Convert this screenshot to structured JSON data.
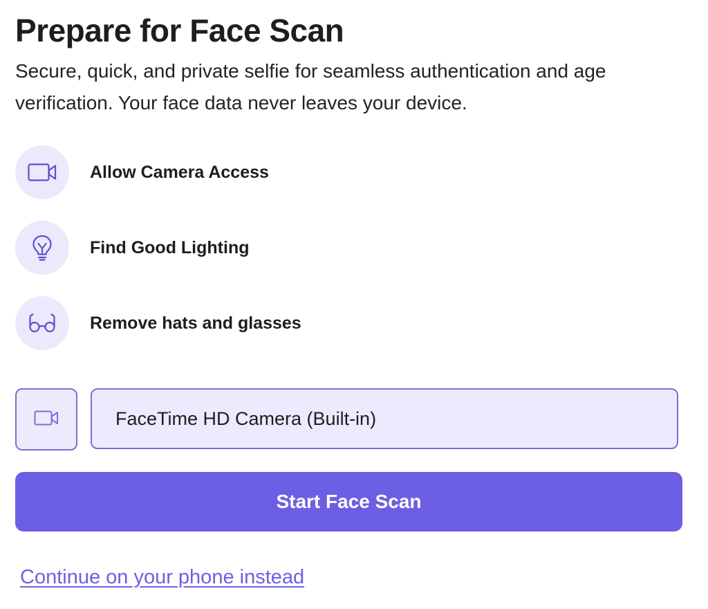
{
  "header": {
    "title": "Prepare for Face Scan",
    "subtitle": "Secure, quick, and private selfie for seamless authentication and age verification. Your face data never leaves your device."
  },
  "steps": [
    {
      "icon": "video-camera-icon",
      "label": "Allow Camera Access"
    },
    {
      "icon": "lightbulb-icon",
      "label": "Find Good Lighting"
    },
    {
      "icon": "glasses-icon",
      "label": "Remove hats and glasses"
    }
  ],
  "camera_select": {
    "icon": "video-camera-icon",
    "value": "FaceTime HD Camera (Built-in)"
  },
  "actions": {
    "start_label": "Start Face Scan",
    "phone_link_label": "Continue on your phone instead"
  },
  "colors": {
    "accent": "#6c5fe4",
    "accent_border": "#7b6ed6",
    "icon_bg": "#ebe9fb",
    "field_bg": "#eceafc",
    "text": "#1d1d22"
  }
}
